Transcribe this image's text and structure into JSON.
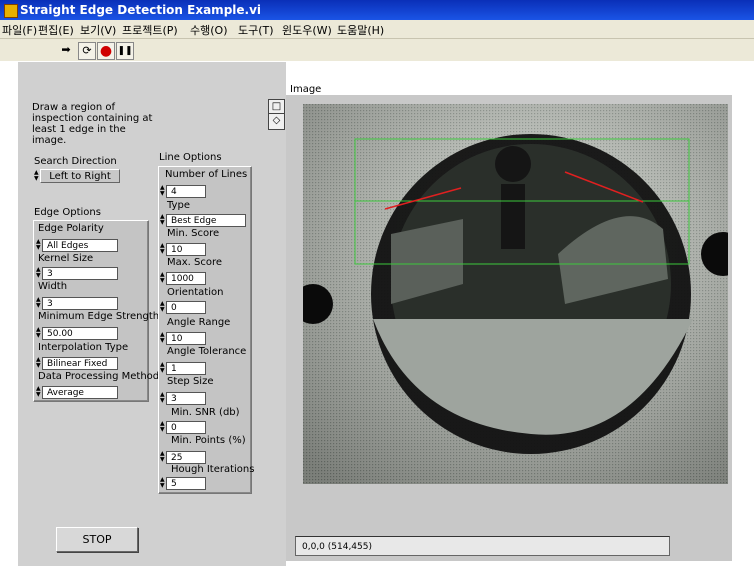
{
  "window": {
    "title": "Straight Edge Detection Example.vi"
  },
  "menu": [
    "파일(F)",
    "편집(E)",
    "보기(V)",
    "프로젝트(P)",
    "수행(O)",
    "도구(T)",
    "윈도우(W)",
    "도움말(H)"
  ],
  "toolbar": {
    "run_glyph": "➡",
    "cont_glyph": "⟳",
    "abort_glyph": "●",
    "pause_glyph": "❚❚"
  },
  "instructions": {
    "line1": "Draw a region of",
    "line2": "inspection containing at",
    "line3": "least 1 edge in the",
    "line4": "image."
  },
  "search_direction": {
    "label": "Search Direction",
    "value": "Left to Right"
  },
  "edge_options": {
    "title": "Edge Options",
    "edge_polarity": {
      "label": "Edge Polarity",
      "value": "All Edges"
    },
    "kernel_size": {
      "label": "Kernel Size",
      "value": "3"
    },
    "width": {
      "label": "Width",
      "value": "3"
    },
    "min_edge_strength": {
      "label": "Minimum Edge Strength",
      "value": "50.00"
    },
    "interpolation_type": {
      "label": "Interpolation Type",
      "value": "Bilinear Fixed"
    },
    "data_processing": {
      "label": "Data Processing Method",
      "value": "Average"
    }
  },
  "line_options": {
    "title": "Line Options",
    "number_of_lines": {
      "label": "Number of Lines",
      "value": "4"
    },
    "type": {
      "label": "Type",
      "value": "Best Edge"
    },
    "min_score": {
      "label": "Min. Score",
      "value": "10"
    },
    "max_score": {
      "label": "Max. Score",
      "value": "1000"
    },
    "orientation": {
      "label": "Orientation",
      "value": "0"
    },
    "angle_range": {
      "label": "Angle Range",
      "value": "10"
    },
    "angle_tolerance": {
      "label": "Angle Tolerance",
      "value": "1"
    },
    "step_size": {
      "label": "Step Size",
      "value": "3"
    },
    "min_snr": {
      "label": "Min. SNR (db)",
      "value": "0"
    },
    "min_points": {
      "label": "Min. Points (%)",
      "value": "25"
    },
    "hough_iterations": {
      "label": "Hough Iterations",
      "value": "5"
    }
  },
  "stop_button": {
    "label": "STOP"
  },
  "image_display": {
    "label": "Image",
    "coords": "0,0,0     (514,455)"
  },
  "image_tools": {
    "rect": "□",
    "point": "◇"
  },
  "colors": {
    "roi": "#3cc83c",
    "edge": "#e02020"
  }
}
